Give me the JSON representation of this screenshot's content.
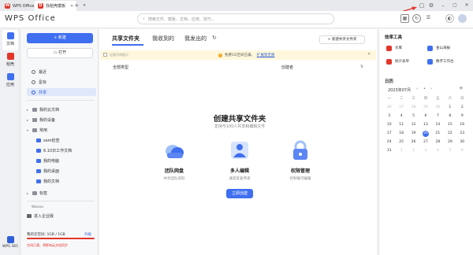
{
  "tabs": [
    {
      "label": "WPS Office",
      "active": false
    },
    {
      "label": "找稻壳模板",
      "active": true
    }
  ],
  "brand": "WPS Office",
  "search": {
    "placeholder": "搜索文件、模板、文档、应用、技巧..."
  },
  "rail": [
    {
      "label": "文档",
      "color": "#3f6ff0"
    },
    {
      "label": "稻壳",
      "color": "#e2352a"
    },
    {
      "label": "应用",
      "color": "#3f6ff0"
    }
  ],
  "rail_bottom": "WPS 365",
  "sidebar": {
    "new_label": "+ 新建",
    "open_label": "打开",
    "nav": [
      {
        "label": "最近"
      },
      {
        "label": "星标"
      },
      {
        "label": "共享",
        "active": true
      }
    ],
    "tree": [
      {
        "label": "我的云文档",
        "level": 0
      },
      {
        "label": "我的设备",
        "level": 0
      },
      {
        "label": "常用",
        "level": 0
      },
      {
        "label": "sem检查",
        "level": 1
      },
      {
        "label": "6.10日工作文档",
        "level": 1
      },
      {
        "label": "我的电脑",
        "level": 1
      },
      {
        "label": "我的桌面",
        "level": 1
      },
      {
        "label": "我的文档",
        "level": 1
      },
      {
        "label": "标签",
        "level": 0
      }
    ],
    "user": "Waexu",
    "enterprise": "进入企业版",
    "space_label": "我的云空间: 1GB / 1GB",
    "upgrade": "升级",
    "space_warning": "空间已满，将影响云文档同步"
  },
  "main": {
    "tabs": [
      "共享文件夹",
      "我收到的",
      "我发出的"
    ],
    "refresh_icon": "refresh-icon",
    "new_shared_label": "+ 新建共享文件夹",
    "notice_left": "近期不再提示",
    "notice_text": "免费1G空间已满。",
    "notice_link": "扩展到无限",
    "columns": {
      "type": "全部类型",
      "owner": "创建者"
    },
    "empty_title": "创建共享文件夹",
    "empty_sub": "支持与100人共享和编辑文件",
    "features": [
      {
        "title": "团队网盘",
        "sub": "共享团队资料"
      },
      {
        "title": "多人编辑",
        "sub": "通常反复传递"
      },
      {
        "title": "权限管理",
        "sub": "控制谁可编辑"
      }
    ],
    "create_label": "立即创建"
  },
  "right": {
    "tools_title": "效率工具",
    "tools": [
      {
        "label": "文库",
        "color": "#e2352a"
      },
      {
        "label": "金山海报",
        "color": "#3f6ff0"
      },
      {
        "label": "统计表单",
        "color": "#e2352a"
      },
      {
        "label": "数字工作台",
        "color": "#3f6ff0"
      }
    ],
    "calendar_title": "日历",
    "month": "2023年07月",
    "weekdays": [
      "一",
      "二",
      "三",
      "四",
      "五",
      "六",
      "日"
    ],
    "days": [
      "26",
      "27",
      "28",
      "29",
      "30",
      "1",
      "2",
      "3",
      "4",
      "5",
      "6",
      "7",
      "8",
      "9",
      "10",
      "11",
      "12",
      "13",
      "14",
      "15",
      "16",
      "17",
      "18",
      "19",
      "20",
      "21",
      "22",
      "23",
      "24",
      "25",
      "26",
      "27",
      "28",
      "29",
      "30",
      "31",
      "1",
      "2",
      "3",
      "4",
      "5",
      "6"
    ],
    "today": "20"
  },
  "accent": "#3f6ff0"
}
